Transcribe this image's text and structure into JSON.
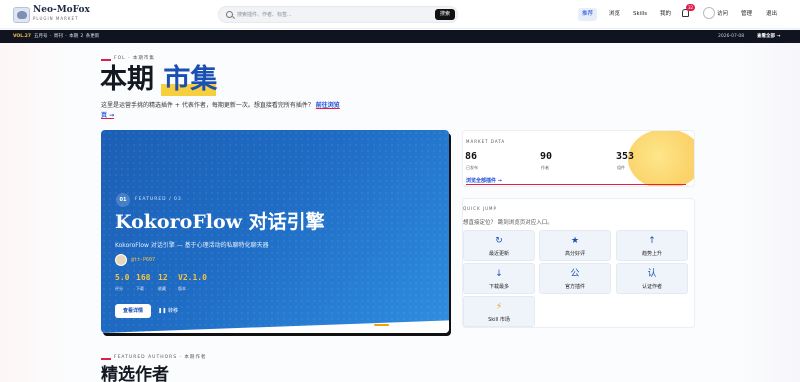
{
  "header": {
    "brand": "Neo-MoFox",
    "brand_sub": "PLUGIN MARKET",
    "search_placeholder": "搜索插件、作者、标签...",
    "search_button": "搜索",
    "nav": [
      "推荐",
      "浏览",
      "Skills",
      "我的"
    ],
    "active_nav": "推荐",
    "notification_count": "32",
    "user_links": [
      "访问",
      "管理",
      "退出"
    ]
  },
  "ticker": {
    "vol": "VOL.27",
    "items": "五月号 · 周刊 · 本期 2 条更新",
    "date": "2026-07-08",
    "view_all": "查看全部 →"
  },
  "hero": {
    "eyebrow": "FOL · 本期市集",
    "title_plain": "本期",
    "title_accent": "市集",
    "intro": "这里是运营手挑的精选插件 + 代表作者，每期更新一次。想直接看完所有插件？",
    "intro_link": "前往浏览页 →"
  },
  "featured": {
    "number": "01",
    "label": "FEATURED / 03",
    "title": "KokoroFlow 对话引擎",
    "desc": "KokoroFlow 对话引擎 — 基于心理活动的私聊特化聊天器",
    "author": "@tt-P607",
    "stats": [
      {
        "value": "5.0",
        "label": "评分"
      },
      {
        "value": "168",
        "label": "下载"
      },
      {
        "value": "12",
        "label": "收藏"
      },
      {
        "value": "V2.1.0",
        "label": "版本"
      }
    ],
    "detail_button": "查看详情",
    "next_button": "❚❚ 转移"
  },
  "market": {
    "label": "MARKET DATA",
    "stats": [
      {
        "value": "86",
        "label": "已发布"
      },
      {
        "value": "90",
        "label": "作者"
      },
      {
        "value": "353",
        "label": "组件"
      }
    ],
    "link": "浏览全部插件 →"
  },
  "quick_jump": {
    "label": "QUICK JUMP",
    "desc": "想直接定位？ 跳到浏览页对应入口。",
    "tiles": [
      {
        "icon": "↻",
        "label": "最近更新"
      },
      {
        "icon": "★",
        "label": "高分好评"
      },
      {
        "icon": "↑",
        "label": "趋势上升"
      },
      {
        "icon": "↓",
        "label": "下载最多"
      },
      {
        "icon": "公",
        "label": "官方插件"
      },
      {
        "icon": "认",
        "label": "认证作者"
      },
      {
        "icon": "⚡",
        "label": "Skill 市场"
      }
    ]
  },
  "authors": {
    "eyebrow": "FEATURED AUTHORS · 本期作者",
    "title": "精选作者"
  },
  "colors": {
    "accent_blue": "#1a4fb4",
    "highlight_yellow": "#f6cf3f",
    "red_rule": "#e11d48",
    "ticker_bg": "#0f1420"
  }
}
